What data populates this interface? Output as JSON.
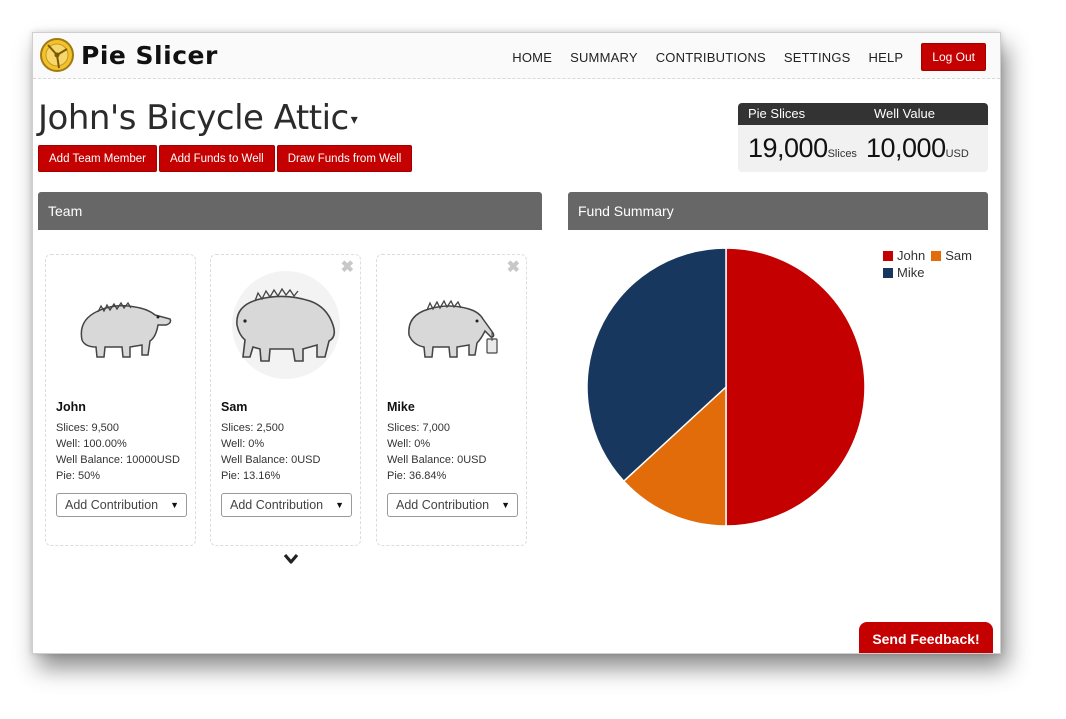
{
  "app": {
    "name": "Pie Slicer"
  },
  "nav": {
    "items": [
      "HOME",
      "SUMMARY",
      "CONTRIBUTIONS",
      "SETTINGS",
      "HELP"
    ],
    "logout": "Log Out"
  },
  "project": {
    "title": "John's Bicycle Attic"
  },
  "actions": {
    "add_member": "Add Team Member",
    "add_funds": "Add Funds to Well",
    "draw_funds": "Draw Funds from Well"
  },
  "stats": {
    "slices_label": "Pie Slices",
    "slices_value": "19,000",
    "slices_unit": "Slices",
    "well_label": "Well Value",
    "well_value": "10,000",
    "well_unit": "USD"
  },
  "panels": {
    "team": "Team",
    "fund": "Fund Summary"
  },
  "team": [
    {
      "name": "John",
      "slices": "Slices: 9,500",
      "well": "Well: 100.00%",
      "balance": "Well Balance: 10000USD",
      "pie": "Pie: 50%",
      "select": "Add Contribution"
    },
    {
      "name": "Sam",
      "slices": "Slices: 2,500",
      "well": "Well: 0%",
      "balance": "Well Balance: 0USD",
      "pie": "Pie: 13.16%",
      "select": "Add Contribution"
    },
    {
      "name": "Mike",
      "slices": "Slices: 7,000",
      "well": "Well: 0%",
      "balance": "Well Balance: 0USD",
      "pie": "Pie: 36.84%",
      "select": "Add Contribution"
    }
  ],
  "chart_data": {
    "type": "pie",
    "categories": [
      "John",
      "Sam",
      "Mike"
    ],
    "values": [
      50,
      13.16,
      36.84
    ],
    "colors": [
      "#c40000",
      "#e36c0a",
      "#17375e"
    ],
    "legend_position": "top-right"
  },
  "feedback": {
    "label": "Send Feedback!"
  },
  "icons": {
    "logo": "pie-logo-icon",
    "close": "close-icon",
    "expand": "chevron-down-icon",
    "member_avatar": "anteater-avatar-icon"
  }
}
